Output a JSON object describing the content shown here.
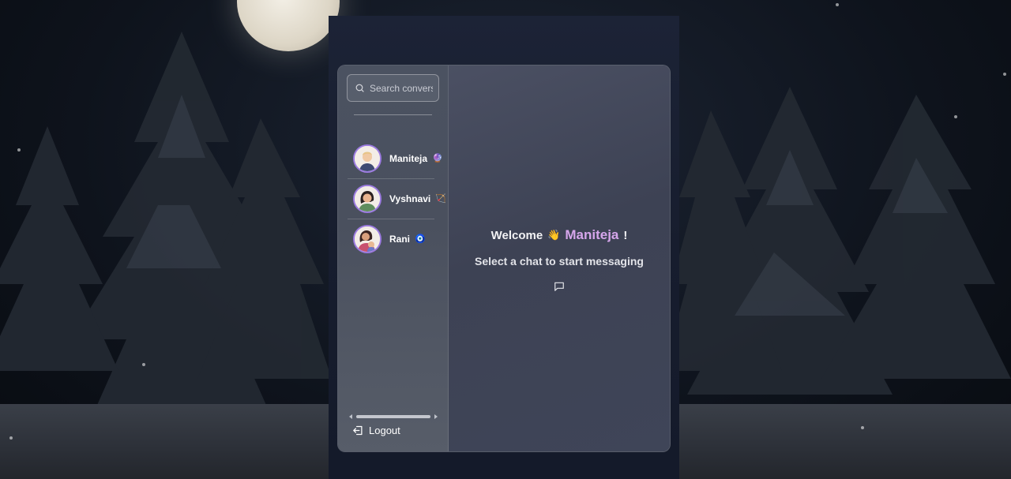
{
  "search": {
    "placeholder": "Search conversations"
  },
  "conversations": [
    {
      "name": "Maniteja",
      "emoji": "🔮",
      "avatar": "male-avatar"
    },
    {
      "name": "Vyshnavi",
      "emoji": "🏹",
      "avatar": "female-avatar"
    },
    {
      "name": "Rani",
      "emoji": "🧿",
      "avatar": "mother-child-avatar"
    }
  ],
  "logout": {
    "label": "Logout",
    "icon": "logout-icon"
  },
  "main": {
    "welcome_prefix": "Welcome",
    "wave_emoji": "👋",
    "username": "Maniteja",
    "exclaim": "!",
    "subtitle": "Select a chat to start messaging",
    "icon": "message-square-icon"
  },
  "colors": {
    "accent": "#9b7ae0",
    "username": "#d6a6ec"
  }
}
